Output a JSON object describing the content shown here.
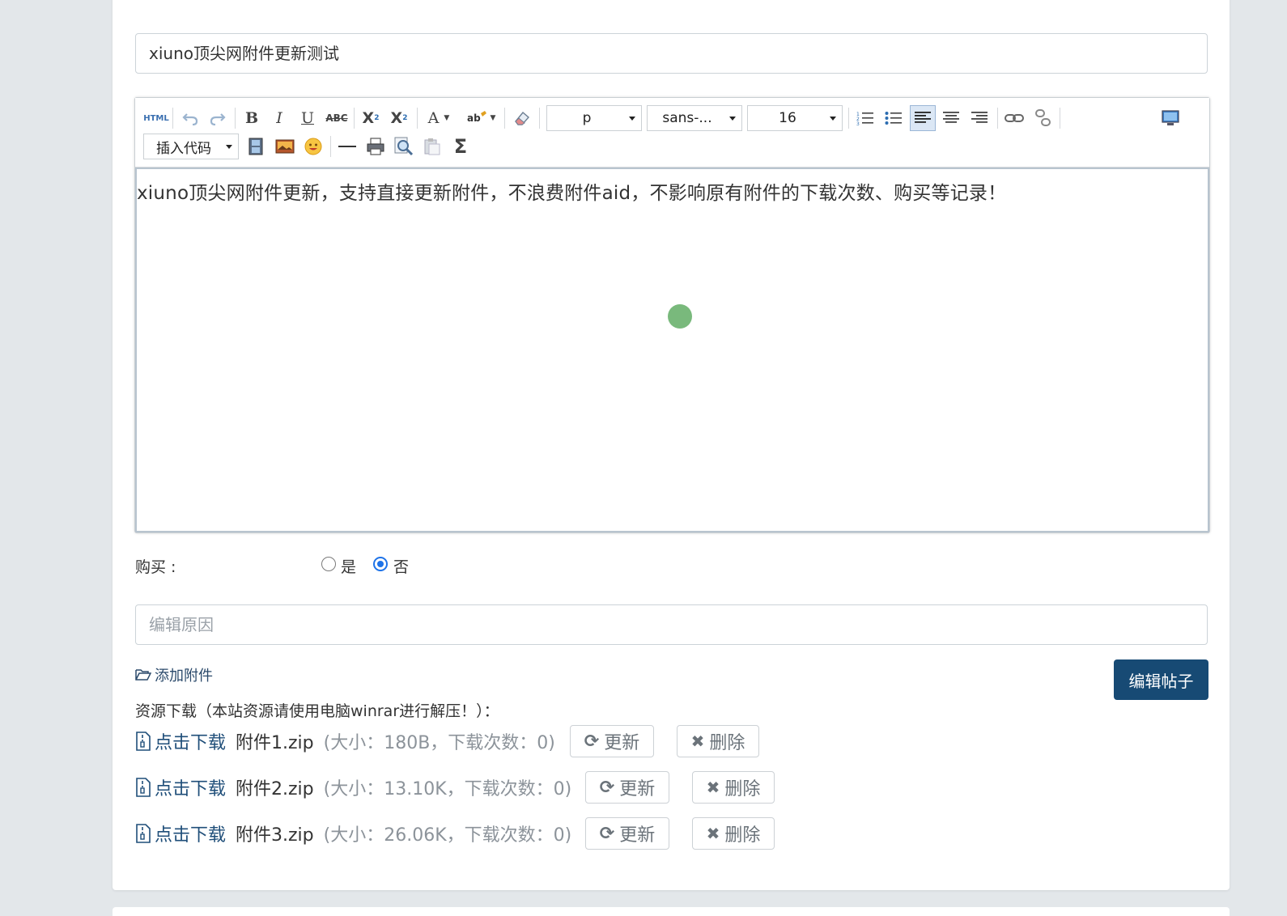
{
  "title_value": "xiuno顶尖网附件更新测试",
  "toolbar": {
    "html_label": "HTML",
    "format_value": "p",
    "font_value": "sans-...",
    "size_value": "16",
    "insert_code_label": "插入代码"
  },
  "editor_content": "xiuno顶尖网附件更新，支持直接更新附件，不浪费附件aid，不影响原有附件的下载次数、购买等记录！",
  "purchase": {
    "label": "购买 :",
    "yes_label": "是",
    "no_label": "否",
    "selected": "否"
  },
  "reason_placeholder": "编辑原因",
  "add_attachment_label": "添加附件",
  "submit_label": "编辑帖子",
  "resources": {
    "title": "资源下载（本站资源请使用电脑winrar进行解压！）：",
    "items": [
      {
        "link": "点击下载",
        "name": "附件1.zip",
        "meta": "(大小：180B，下载次数：0)",
        "update": "更新",
        "delete": "删除"
      },
      {
        "link": "点击下载",
        "name": "附件2.zip",
        "meta": "(大小：13.10K，下载次数：0)",
        "update": "更新",
        "delete": "删除"
      },
      {
        "link": "点击下载",
        "name": "附件3.zip",
        "meta": "(大小：26.06K，下载次数：0)",
        "update": "更新",
        "delete": "删除"
      }
    ]
  },
  "colors": {
    "primary": "#174a74",
    "link": "#1f4e79",
    "radio_selected": "#1e73e8"
  }
}
